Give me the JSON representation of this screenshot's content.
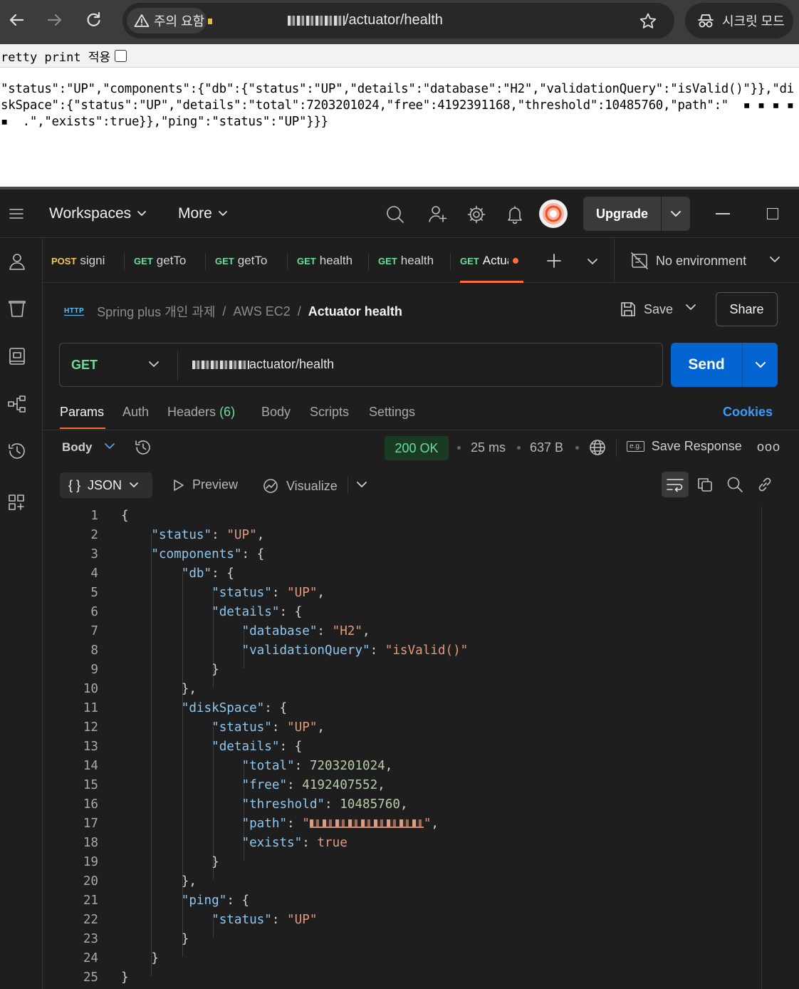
{
  "browser": {
    "warning_chip": "주의 요함",
    "url_path": "/actuator/health",
    "incognito_label": "시크릿 모드"
  },
  "raw_page": {
    "pretty_print_label": "retty print 적용",
    "json_text": "\"status\":\"UP\",\"components\":{\"db\":{\"status\":\"UP\",\"details\":\"database\":\"H2\",\"validationQuery\":\"isValid()\"}},\"diskSpace\":{\"status\":\"UP\",\"details\":\"total\":7203201024,\"free\":4192391168,\"threshold\":10485760,\"path\":\"  ▪ ▪ ▪ ▪ ▪  .\",\"exists\":true}},\"ping\":\"status\":\"UP\"}}}"
  },
  "topbar": {
    "workspaces_label": "Workspaces",
    "more_label": "More",
    "upgrade_label": "Upgrade"
  },
  "tabs": [
    {
      "method": "POST",
      "name": "signi"
    },
    {
      "method": "GET",
      "name": "getTo"
    },
    {
      "method": "GET",
      "name": "getTo"
    },
    {
      "method": "GET",
      "name": "health"
    },
    {
      "method": "GET",
      "name": "health"
    },
    {
      "method": "GET",
      "name": "Actua"
    }
  ],
  "environment_label": "No environment",
  "breadcrumb": {
    "http_badge": "HTTP",
    "collection": "Spring plus 개인 과제",
    "folder": "AWS EC2",
    "separator": "/",
    "request_name": "Actuator health"
  },
  "save_label": "Save",
  "share_label": "Share",
  "request": {
    "method": "GET",
    "url_path": "actuator/health",
    "send_label": "Send"
  },
  "request_tabs": {
    "params": "Params",
    "auth": "Auth",
    "headers": "Headers",
    "headers_count": "(6)",
    "body": "Body",
    "scripts": "Scripts",
    "settings": "Settings",
    "cookies": "Cookies"
  },
  "response": {
    "body_label": "Body",
    "status": "200 OK",
    "time": "25 ms",
    "size": "637 B",
    "save_response_badge": "e.g.",
    "save_response_label": "Save Response",
    "more_label": "ooo",
    "format_braces": "{ }",
    "format_label": "JSON",
    "preview_label": "Preview",
    "visualize_label": "Visualize"
  },
  "json_body": {
    "l1": "{",
    "status_key": "\"status\"",
    "up": "\"UP\"",
    "components_key": "\"components\"",
    "db_key": "\"db\"",
    "details_key": "\"details\"",
    "database_key": "\"database\"",
    "database_val": "\"H2\"",
    "validation_key": "\"validationQuery\"",
    "validation_val": "\"isValid()\"",
    "diskspace_key": "\"diskSpace\"",
    "total_key": "\"total\"",
    "total_val": "7203201024",
    "free_key": "\"free\"",
    "free_val": "4192407552",
    "threshold_key": "\"threshold\"",
    "threshold_val": "10485760",
    "path_key": "\"path\"",
    "exists_key": "\"exists\"",
    "exists_val": "true",
    "ping_key": "\"ping\""
  },
  "line_numbers": [
    "1",
    "2",
    "3",
    "4",
    "5",
    "6",
    "7",
    "8",
    "9",
    "10",
    "11",
    "12",
    "13",
    "14",
    "15",
    "16",
    "17",
    "18",
    "19",
    "20",
    "21",
    "22",
    "23",
    "24",
    "25"
  ]
}
